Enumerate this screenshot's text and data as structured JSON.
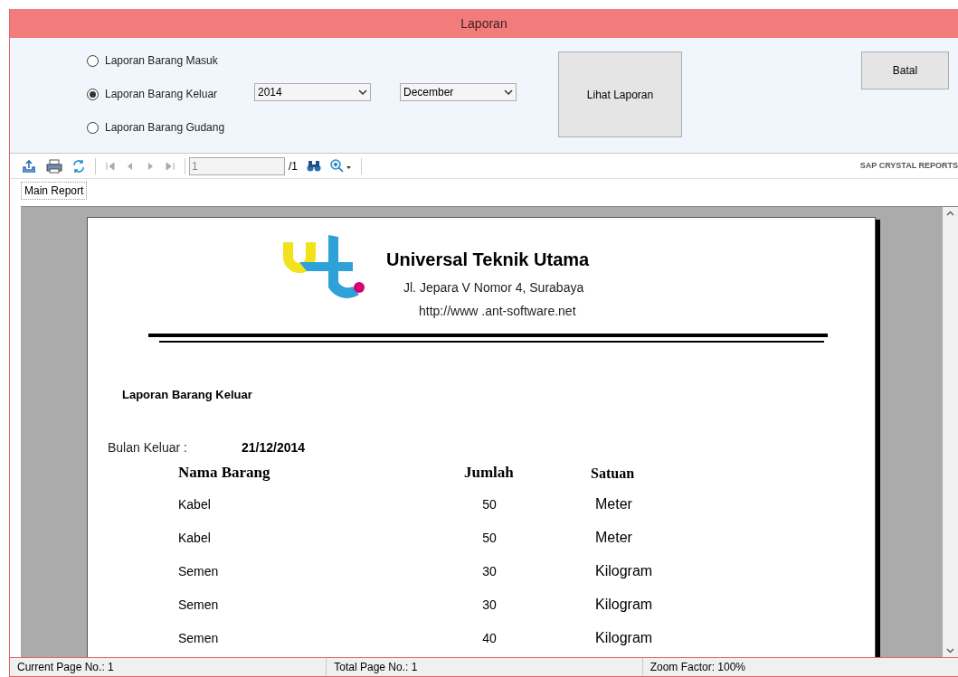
{
  "window": {
    "title": "Laporan"
  },
  "report_types": [
    {
      "label": "Laporan Barang Masuk",
      "selected": false
    },
    {
      "label": "Laporan Barang Keluar",
      "selected": true
    },
    {
      "label": "Laporan Barang Gudang",
      "selected": false
    }
  ],
  "year_combo": {
    "value": "2014"
  },
  "month_combo": {
    "value": "December"
  },
  "view_button": {
    "label": "Lihat Laporan"
  },
  "cancel_button": {
    "label": "Batal"
  },
  "viewer": {
    "toolbar": {
      "page_field": "1",
      "page_total": "/1",
      "brand": "SAP CRYSTAL REPORTS"
    },
    "tabs": [
      {
        "label": "Main Report",
        "selected": true
      }
    ],
    "report": {
      "company": "Universal Teknik Utama",
      "address": "Jl. Jepara V Nomor 4, Surabaya",
      "website": "http://www .ant-software.net",
      "title": "Laporan Barang Keluar",
      "month_label": "Bulan Keluar :",
      "month_value": "21/12/2014",
      "columns": [
        "Nama Barang",
        "Jumlah",
        "Satuan"
      ],
      "rows": [
        [
          "Kabel",
          "50",
          "Meter"
        ],
        [
          "Kabel",
          "50",
          "Meter"
        ],
        [
          "Semen",
          "30",
          "Kilogram"
        ],
        [
          "Semen",
          "30",
          "Kilogram"
        ],
        [
          "Semen",
          "40",
          "Kilogram"
        ]
      ]
    }
  },
  "status_bar": [
    "Current Page No.: 1",
    "Total Page No.: 1",
    "Zoom Factor: 100%"
  ]
}
